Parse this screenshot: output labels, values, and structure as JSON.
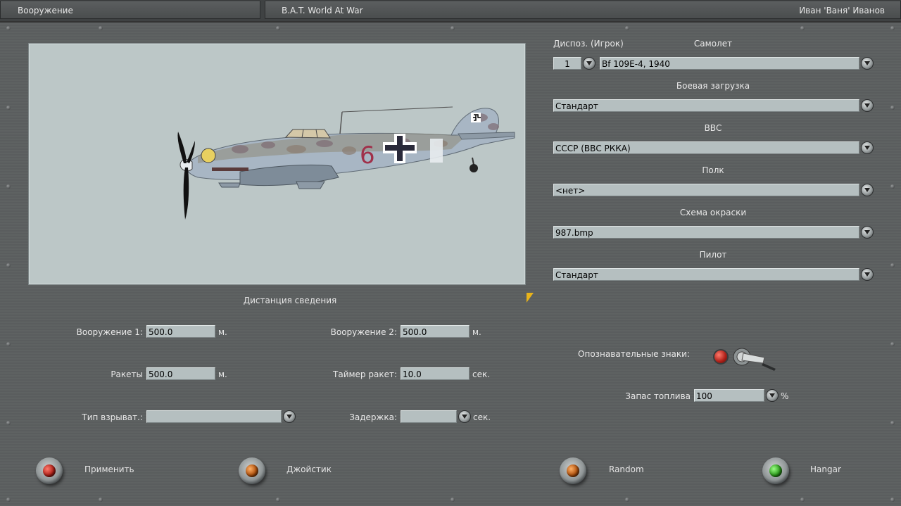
{
  "titlebar": {
    "section": "Вооружение",
    "app": "B.A.T. World At War",
    "user": "Иван 'Ваня' Иванов"
  },
  "top_labels": {
    "dispos": "Диспоз. (Игрок)",
    "aircraft": "Самолет"
  },
  "fields": {
    "dispos_value": "1",
    "aircraft_value": "Bf 109E-4, 1940",
    "loadout_label": "Боевая загрузка",
    "loadout_value": "Стандарт",
    "airforce_label": "ВВС",
    "airforce_value": "СССР (ВВС РККА)",
    "regiment_label": "Полк",
    "regiment_value": "<нет>",
    "skin_label": "Схема окраски",
    "skin_value": "987.bmp",
    "pilot_label": "Пилот",
    "pilot_value": "Стандарт"
  },
  "convergence": {
    "title": "Дистанция сведения",
    "weapon1_label": "Вооружение 1:",
    "weapon1_value": "500.0",
    "weapon2_label": "Вооружение 2:",
    "weapon2_value": "500.0",
    "rockets_label": "Ракеты",
    "rockets_value": "500.0",
    "rocket_timer_label": "Таймер ракет:",
    "rocket_timer_value": "10.0",
    "fuze_label": "Тип взрыват.:",
    "fuze_value": "",
    "delay_label": "Задержка:",
    "delay_value": "",
    "unit_m": "м.",
    "unit_sec": "сек."
  },
  "markings": {
    "label": "Опознавательные знаки:"
  },
  "fuel": {
    "label": "Запас топлива",
    "value": "100",
    "unit": "%"
  },
  "buttons": {
    "apply": "Применить",
    "joystick": "Джойстик",
    "random": "Random",
    "hangar": "Hangar"
  },
  "colors": {
    "panel": "#5c5f60",
    "field": "#b5bfc0",
    "lamp_red": "#b1221a",
    "lamp_orange": "#b0520f",
    "lamp_green": "#2c9b1b"
  }
}
